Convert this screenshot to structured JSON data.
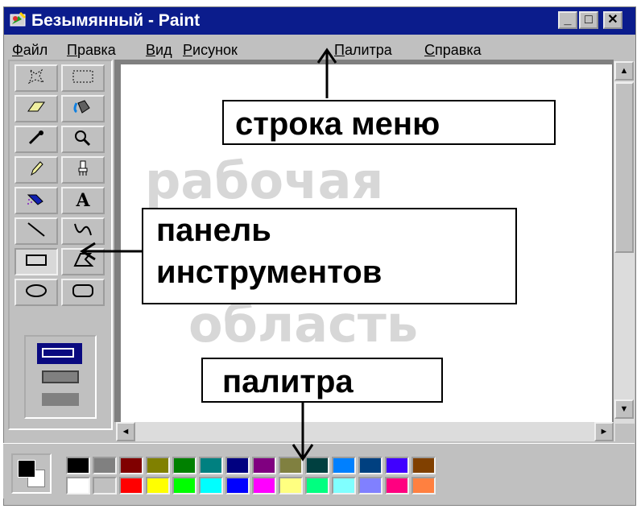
{
  "window": {
    "title": "Безымянный - Paint",
    "minimize_label": "_",
    "maximize_label": "□",
    "close_label": "✕"
  },
  "menu": {
    "items": [
      {
        "label_first": "Ф",
        "label_rest": "айл"
      },
      {
        "label_first": "П",
        "label_rest": "равка"
      },
      {
        "label_first": "В",
        "label_rest": "ид"
      },
      {
        "label_first": "Р",
        "label_rest": "исунок"
      },
      {
        "label_first": "П",
        "label_rest": "алитра"
      },
      {
        "label_first": "С",
        "label_rest": "правка"
      }
    ]
  },
  "tools": [
    {
      "name": "free-form-select-icon"
    },
    {
      "name": "select-icon"
    },
    {
      "name": "eraser-icon"
    },
    {
      "name": "fill-bucket-icon"
    },
    {
      "name": "color-picker-icon"
    },
    {
      "name": "magnifier-icon"
    },
    {
      "name": "pencil-icon"
    },
    {
      "name": "brush-icon"
    },
    {
      "name": "airbrush-icon"
    },
    {
      "name": "text-icon",
      "glyph": "A"
    },
    {
      "name": "line-icon"
    },
    {
      "name": "curve-icon"
    },
    {
      "name": "rectangle-icon",
      "pressed": true
    },
    {
      "name": "polygon-icon"
    },
    {
      "name": "ellipse-icon"
    },
    {
      "name": "rounded-rectangle-icon"
    }
  ],
  "canvas_ghost": {
    "line1": "рабочая",
    "line2": "область"
  },
  "callouts": {
    "menu": "строка меню",
    "toolbar_line1": "панель",
    "toolbar_line2": "инструментов",
    "palette": "палитра"
  },
  "palette": {
    "foreground": "#000000",
    "background": "#ffffff",
    "top": [
      "#000000",
      "#808080",
      "#800000",
      "#808000",
      "#008000",
      "#008080",
      "#000080",
      "#800080",
      "#808040",
      "#004040",
      "#0080ff",
      "#004080",
      "#4000ff",
      "#804000"
    ],
    "bottom": [
      "#ffffff",
      "#c0c0c0",
      "#ff0000",
      "#ffff00",
      "#00ff00",
      "#00ffff",
      "#0000ff",
      "#ff00ff",
      "#ffff80",
      "#00ff80",
      "#80ffff",
      "#8080ff",
      "#ff0080",
      "#ff8040"
    ]
  },
  "colors": {
    "title_bar": "#0b1c8c",
    "face": "#c0c0c0"
  }
}
